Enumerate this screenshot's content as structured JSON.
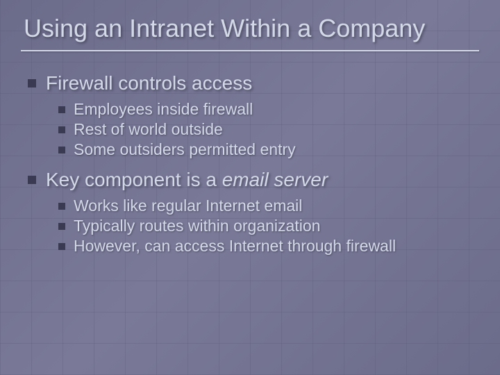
{
  "title": "Using an Intranet Within a Company",
  "sections": [
    {
      "heading": "Firewall controls access",
      "items": [
        "Employees inside firewall",
        "Rest of world outside",
        "Some outsiders permitted entry"
      ]
    },
    {
      "heading_prefix": "Key component is a ",
      "heading_italic": "email server",
      "items": [
        "Works like regular Internet email",
        "Typically routes within organization",
        "However, can access Internet through firewall"
      ]
    }
  ]
}
